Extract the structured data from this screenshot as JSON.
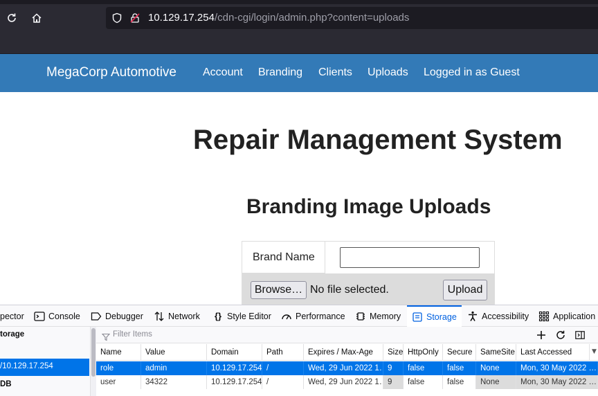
{
  "browser": {
    "url_host": "10.129.17.254",
    "url_path": "/cdn-cgi/login/admin.php?content=uploads"
  },
  "navbar": {
    "brand": "MegaCorp Automotive",
    "links": [
      "Account",
      "Branding",
      "Clients",
      "Uploads",
      "Logged in as Guest"
    ],
    "color": "#337ab7"
  },
  "page": {
    "title": "Repair Management System",
    "section_title": "Branding Image Uploads",
    "form": {
      "brand_label": "Brand Name",
      "brand_value": "",
      "browse_label": "Browse…",
      "file_status": "No file selected.",
      "upload_label": "Upload"
    }
  },
  "devtools": {
    "tabs": [
      "pector",
      "Console",
      "Debugger",
      "Network",
      "Style Editor",
      "Performance",
      "Memory",
      "Storage",
      "Accessibility",
      "Application"
    ],
    "active_tab": "Storage",
    "sidebar": {
      "heading": "torage",
      "selected_host": "/10.129.17.254",
      "db_label": "DB"
    },
    "filter_placeholder": "Filter Items",
    "columns": [
      "Name",
      "Value",
      "Domain",
      "Path",
      "Expires / Max-Age",
      "Size",
      "HttpOnly",
      "Secure",
      "SameSite",
      "Last Accessed"
    ],
    "cookies": [
      {
        "name": "role",
        "value": "admin",
        "domain": "10.129.17.254",
        "path": "/",
        "expires": "Wed, 29 Jun 2022 1…",
        "size": "9",
        "httponly": "false",
        "secure": "false",
        "samesite": "None",
        "last_accessed": "Mon, 30 May 2022 …"
      },
      {
        "name": "user",
        "value": "34322",
        "domain": "10.129.17.254",
        "path": "/",
        "expires": "Wed, 29 Jun 2022 1…",
        "size": "9",
        "httponly": "false",
        "secure": "false",
        "samesite": "None",
        "last_accessed": "Mon, 30 May 2022 …"
      }
    ],
    "accent": "#0074e8"
  }
}
